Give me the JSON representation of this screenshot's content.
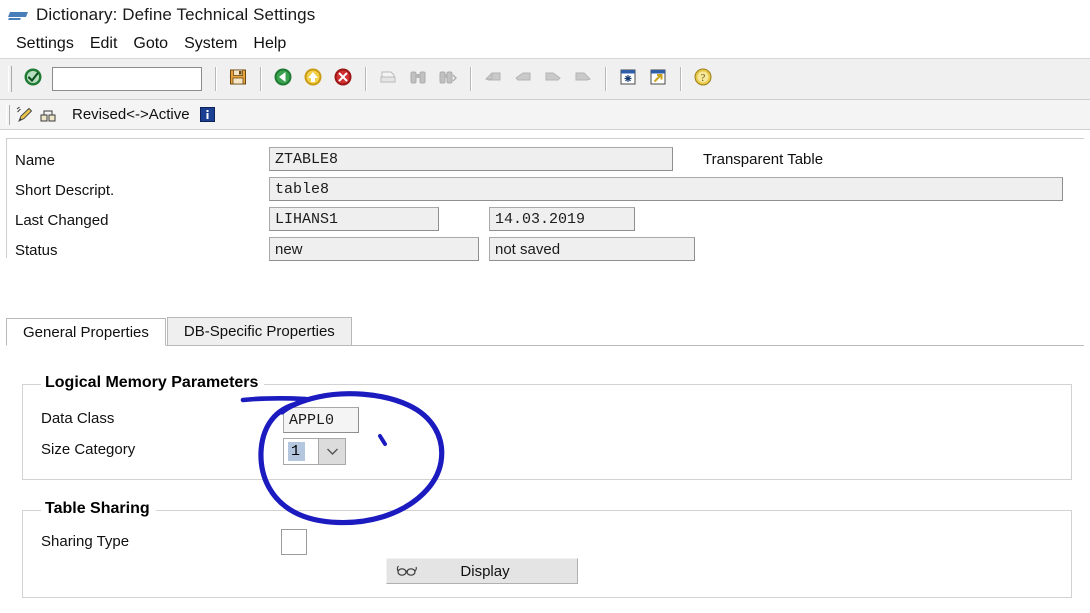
{
  "window": {
    "title": "Dictionary: Define Technical Settings",
    "title_icon": "sap-arrow-icon"
  },
  "menubar": {
    "items": [
      {
        "label": "Settings",
        "name": "menu-settings"
      },
      {
        "label": "Edit",
        "name": "menu-edit"
      },
      {
        "label": "Goto",
        "name": "menu-goto"
      },
      {
        "label": "System",
        "name": "menu-system"
      },
      {
        "label": "Help",
        "name": "menu-help"
      }
    ]
  },
  "toolbar": {
    "command_field": {
      "value": "",
      "placeholder": ""
    },
    "buttons": [
      {
        "icon": "enter-check-icon",
        "name": "enter-button"
      },
      {
        "icon": "save-disk-icon",
        "name": "save-button"
      },
      {
        "icon": "back-green-arrow-icon",
        "name": "back-button"
      },
      {
        "icon": "exit-yellow-arrow-icon",
        "name": "exit-button"
      },
      {
        "icon": "cancel-red-x-icon",
        "name": "cancel-button"
      },
      {
        "icon": "print-icon",
        "name": "print-button"
      },
      {
        "icon": "find-binoculars-icon",
        "name": "find-button"
      },
      {
        "icon": "find-next-binoculars-icon",
        "name": "find-next-button"
      },
      {
        "icon": "first-page-icon",
        "name": "first-page-button"
      },
      {
        "icon": "previous-page-icon",
        "name": "previous-page-button"
      },
      {
        "icon": "next-page-icon",
        "name": "next-page-button"
      },
      {
        "icon": "last-page-icon",
        "name": "last-page-button"
      },
      {
        "icon": "new-session-window-icon",
        "name": "create-session-button"
      },
      {
        "icon": "shortcut-window-icon",
        "name": "create-shortcut-button"
      },
      {
        "icon": "help-question-icon",
        "name": "help-button"
      }
    ]
  },
  "status_strip": {
    "icons": [
      "pencil-edit-icon",
      "hierarchy-nodes-icon"
    ],
    "text": "Revised<->Active",
    "info_icon": "information-icon"
  },
  "header_form": {
    "rows": [
      {
        "label": "Name",
        "value": "ZTABLE8",
        "name": "name"
      },
      {
        "label": "Short Descript.",
        "value": "table8",
        "name": "short-description"
      },
      {
        "label": "Last Changed",
        "value": "LIHANS1",
        "name": "last-changed-user"
      },
      {
        "label": "Status",
        "value": "new",
        "name": "status"
      }
    ],
    "table_type": "Transparent Table",
    "last_changed_date": "14.03.2019",
    "status_saved": "not saved"
  },
  "tabs": [
    {
      "label": "General Properties",
      "name": "tab-general-properties",
      "active": true
    },
    {
      "label": "DB-Specific Properties",
      "name": "tab-db-specific-properties",
      "active": false
    }
  ],
  "logical_memory_parameters": {
    "title": "Logical Memory Parameters",
    "data_class": {
      "label": "Data Class",
      "value": "APPL0"
    },
    "size_category": {
      "label": "Size Category",
      "value": "1",
      "dropdown_icon": "chevron-down-icon"
    }
  },
  "table_sharing": {
    "title": "Table Sharing",
    "sharing_type": {
      "label": "Sharing Type",
      "value": ""
    },
    "display_button": {
      "label": "Display",
      "icon": "glasses-display-icon"
    }
  },
  "annotation": {
    "color": "#1b1bc0",
    "shape": "hand-drawn-ellipse-highlight"
  },
  "colors": {
    "toolbar_bg": "#f0f0f0",
    "field_bg": "#efefef",
    "selection_blue": "#b5c7de",
    "annotation_blue": "#1b1bc0"
  }
}
